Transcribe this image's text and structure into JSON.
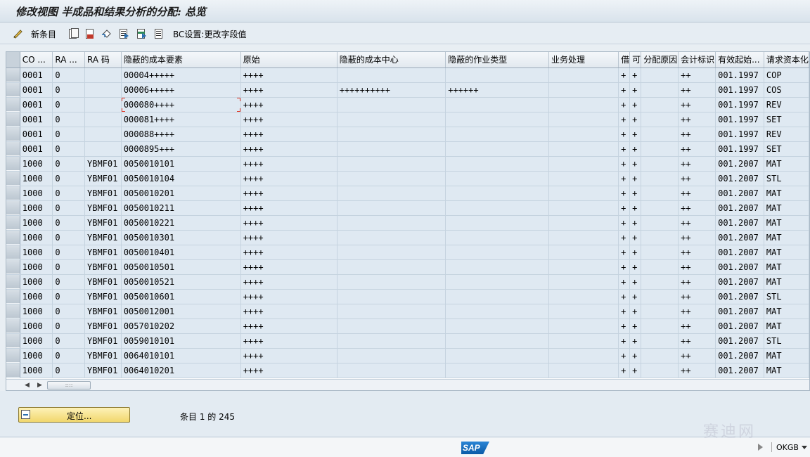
{
  "window": {
    "title": "修改视图 半成品和结果分析的分配: 总览"
  },
  "toolbar": {
    "new_entries_label": "新条目",
    "bc_settings_label": "BC设置:更改字段值"
  },
  "grid": {
    "columns": [
      "CO ...",
      "RA ...",
      "RA 码",
      "隐蔽的成本要素",
      "原始",
      "隐蔽的成本中心",
      "隐蔽的作业类型",
      "业务处理",
      "借",
      "可",
      "分配原因",
      "会计标识",
      "有效起始...",
      "请求资本化"
    ],
    "rows": [
      [
        "0001",
        "0",
        "",
        "00004+++++",
        "++++",
        "",
        "",
        "",
        "+",
        "+",
        "",
        "++",
        "001.1997",
        "COP"
      ],
      [
        "0001",
        "0",
        "",
        "00006+++++",
        "++++",
        "++++++++++",
        "++++++",
        "",
        "+",
        "+",
        "",
        "++",
        "001.1997",
        "COS"
      ],
      [
        "0001",
        "0",
        "",
        "000080++++",
        "++++",
        "",
        "",
        "",
        "+",
        "+",
        "",
        "++",
        "001.1997",
        "REV"
      ],
      [
        "0001",
        "0",
        "",
        "000081++++",
        "++++",
        "",
        "",
        "",
        "+",
        "+",
        "",
        "++",
        "001.1997",
        "SET"
      ],
      [
        "0001",
        "0",
        "",
        "000088++++",
        "++++",
        "",
        "",
        "",
        "+",
        "+",
        "",
        "++",
        "001.1997",
        "REV"
      ],
      [
        "0001",
        "0",
        "",
        "0000895+++",
        "++++",
        "",
        "",
        "",
        "+",
        "+",
        "",
        "++",
        "001.1997",
        "SET"
      ],
      [
        "1000",
        "0",
        "YBMF01",
        "0050010101",
        "++++",
        "",
        "",
        "",
        "+",
        "+",
        "",
        "++",
        "001.2007",
        "MAT"
      ],
      [
        "1000",
        "0",
        "YBMF01",
        "0050010104",
        "++++",
        "",
        "",
        "",
        "+",
        "+",
        "",
        "++",
        "001.2007",
        "STL"
      ],
      [
        "1000",
        "0",
        "YBMF01",
        "0050010201",
        "++++",
        "",
        "",
        "",
        "+",
        "+",
        "",
        "++",
        "001.2007",
        "MAT"
      ],
      [
        "1000",
        "0",
        "YBMF01",
        "0050010211",
        "++++",
        "",
        "",
        "",
        "+",
        "+",
        "",
        "++",
        "001.2007",
        "MAT"
      ],
      [
        "1000",
        "0",
        "YBMF01",
        "0050010221",
        "++++",
        "",
        "",
        "",
        "+",
        "+",
        "",
        "++",
        "001.2007",
        "MAT"
      ],
      [
        "1000",
        "0",
        "YBMF01",
        "0050010301",
        "++++",
        "",
        "",
        "",
        "+",
        "+",
        "",
        "++",
        "001.2007",
        "MAT"
      ],
      [
        "1000",
        "0",
        "YBMF01",
        "0050010401",
        "++++",
        "",
        "",
        "",
        "+",
        "+",
        "",
        "++",
        "001.2007",
        "MAT"
      ],
      [
        "1000",
        "0",
        "YBMF01",
        "0050010501",
        "++++",
        "",
        "",
        "",
        "+",
        "+",
        "",
        "++",
        "001.2007",
        "MAT"
      ],
      [
        "1000",
        "0",
        "YBMF01",
        "0050010521",
        "++++",
        "",
        "",
        "",
        "+",
        "+",
        "",
        "++",
        "001.2007",
        "MAT"
      ],
      [
        "1000",
        "0",
        "YBMF01",
        "0050010601",
        "++++",
        "",
        "",
        "",
        "+",
        "+",
        "",
        "++",
        "001.2007",
        "STL"
      ],
      [
        "1000",
        "0",
        "YBMF01",
        "0050012001",
        "++++",
        "",
        "",
        "",
        "+",
        "+",
        "",
        "++",
        "001.2007",
        "MAT"
      ],
      [
        "1000",
        "0",
        "YBMF01",
        "0057010202",
        "++++",
        "",
        "",
        "",
        "+",
        "+",
        "",
        "++",
        "001.2007",
        "MAT"
      ],
      [
        "1000",
        "0",
        "YBMF01",
        "0059010101",
        "++++",
        "",
        "",
        "",
        "+",
        "+",
        "",
        "++",
        "001.2007",
        "STL"
      ],
      [
        "1000",
        "0",
        "YBMF01",
        "0064010101",
        "++++",
        "",
        "",
        "",
        "+",
        "+",
        "",
        "++",
        "001.2007",
        "MAT"
      ],
      [
        "1000",
        "0",
        "YBMF01",
        "0064010201",
        "++++",
        "",
        "",
        "",
        "+",
        "+",
        "",
        "++",
        "001.2007",
        "MAT"
      ]
    ]
  },
  "footer": {
    "locate_label": "定位...",
    "entry_info": "条目 1 的 245"
  },
  "status": {
    "logo_text": "SAP",
    "transaction": "OKGB"
  },
  "watermark": "赛迪网",
  "colors": {
    "cell_bg": "#dfe9f2",
    "header_bg": "#e2e9ef",
    "locate_button": "#f1d76d",
    "focus_marker": "#e03b2a"
  }
}
